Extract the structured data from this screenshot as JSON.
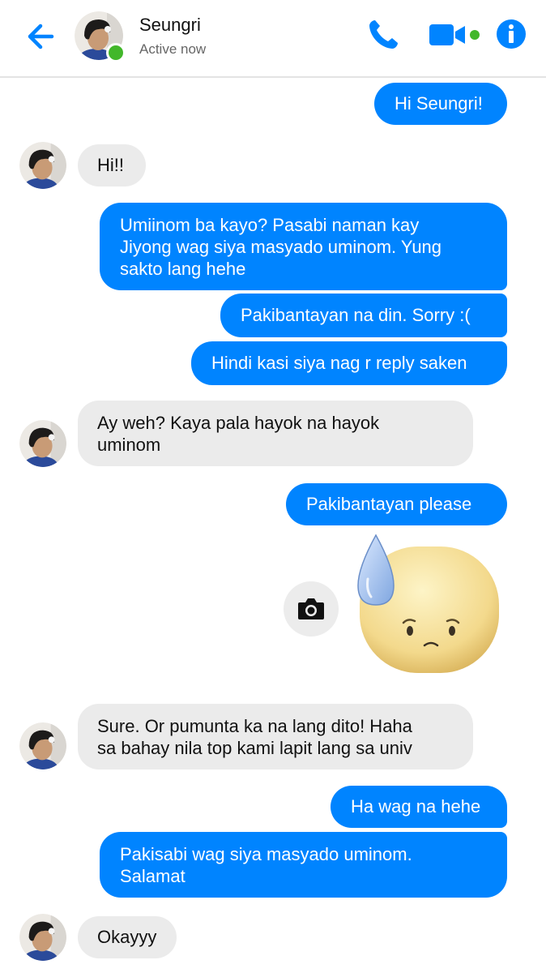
{
  "header": {
    "name": "Seungri",
    "status": "Active now"
  },
  "colors": {
    "accent": "#0084ff",
    "online": "#42b72a",
    "incoming_bubble": "#ebebeb"
  },
  "icons": {
    "back": "back-arrow-icon",
    "phone": "phone-icon",
    "video": "video-camera-icon",
    "info": "info-icon",
    "camera": "camera-icon",
    "sticker": "sweat-drop-sticker"
  },
  "messages": [
    {
      "from": "me",
      "text": "Hi Seungri!"
    },
    {
      "from": "them",
      "text": "Hi!!"
    },
    {
      "from": "me",
      "text": "Umiinom ba kayo? Pasabi naman kay\nJiyong wag siya masyado uminom. Yung\nsakto lang hehe"
    },
    {
      "from": "me",
      "text": "Pakibantayan na din. Sorry :("
    },
    {
      "from": "me",
      "text": "Hindi kasi siya nag r reply saken"
    },
    {
      "from": "them",
      "text": "Ay weh? Kaya pala hayok na hayok\numinom"
    },
    {
      "from": "me",
      "text": "Pakibantayan please"
    },
    {
      "from": "them",
      "text": "Sure. Or pumunta ka na lang dito! Haha\nsa bahay nila top kami lapit lang sa univ"
    },
    {
      "from": "me",
      "text": "Ha wag na hehe"
    },
    {
      "from": "me",
      "text": "Pakisabi wag siya masyado uminom.\nSalamat"
    },
    {
      "from": "them",
      "text": "Okayyy"
    }
  ]
}
